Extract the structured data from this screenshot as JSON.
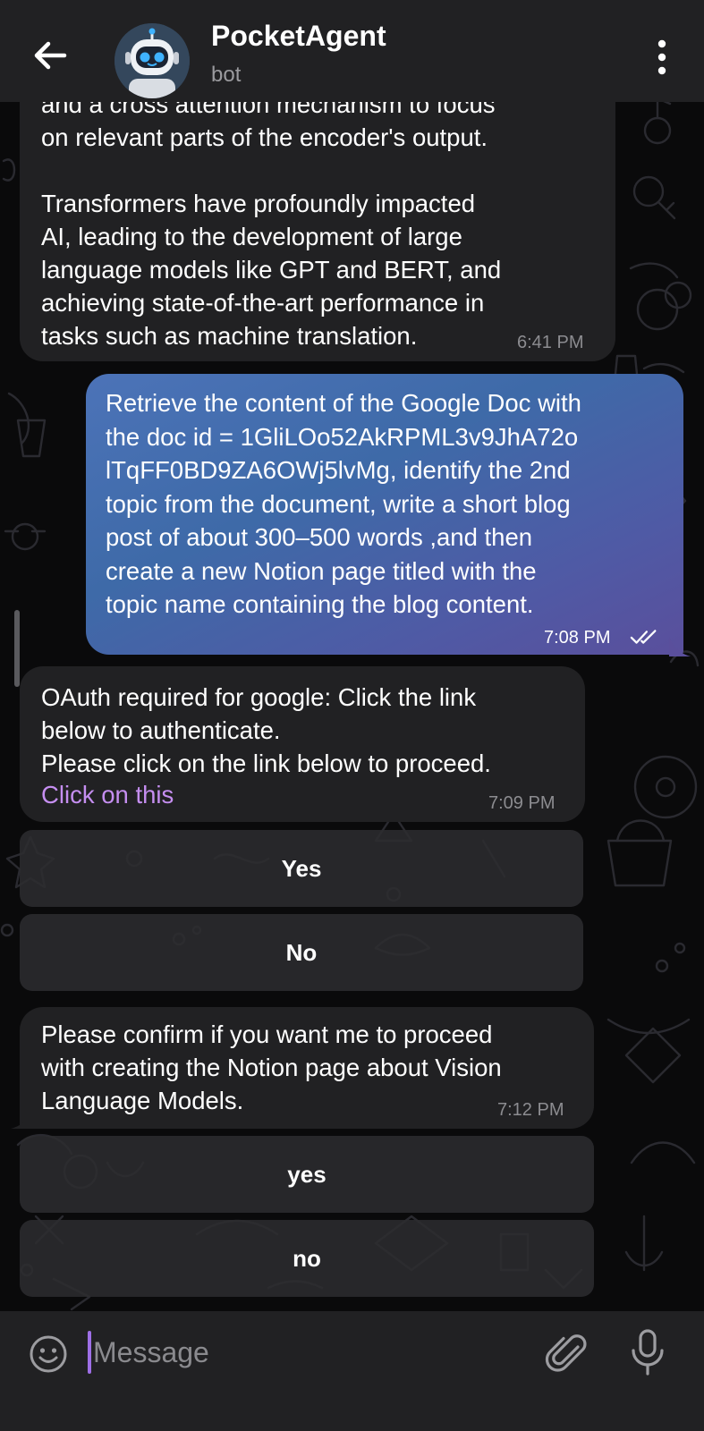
{
  "header": {
    "title": "PocketAgent",
    "subtitle": "bot"
  },
  "messages": [
    {
      "direction": "incoming",
      "text": "and a cross attention mechanism to focus\non relevant parts of the encoder's output.\n\nTransformers have profoundly impacted\nAI, leading to the development of large\nlanguage models like GPT and BERT, and\nachieving state-of-the-art performance in\ntasks such as machine translation.",
      "time": "6:41 PM"
    },
    {
      "direction": "outgoing",
      "text": "Retrieve the content of the Google Doc with\nthe doc id = 1GliLOo52AkRPML3v9JhA72o\nlTqFF0BD9ZA6OWj5lvMg, identify the 2nd\ntopic from the document, write a short blog\npost of about 300–500 words ,and then\ncreate a new Notion page titled with the\ntopic name containing the blog content.",
      "time": "7:08 PM",
      "status": "read"
    },
    {
      "direction": "incoming",
      "text": "OAuth required for google: Click the link\nbelow to authenticate.\nPlease click on the link below to proceed.",
      "link": "Click on this",
      "time": "7:09 PM",
      "buttons": [
        "Yes",
        "No"
      ]
    },
    {
      "direction": "incoming",
      "text": "Please confirm if you want me to proceed\nwith creating the Notion page about Vision\nLanguage Models.",
      "time": "7:12 PM",
      "buttons": [
        "yes",
        "no"
      ]
    }
  ],
  "input": {
    "placeholder": "Message"
  },
  "icons": {
    "back": "arrow-left-icon",
    "menu": "more-vertical-icon",
    "emoji": "smiley-icon",
    "attach": "paperclip-icon",
    "mic": "microphone-icon",
    "read_status": "double-check-icon"
  },
  "colors": {
    "header_bg": "#212123",
    "incoming_bubble": "#212123",
    "outgoing_gradient_start": "#4c73b8",
    "outgoing_gradient_end": "#5a4f9c",
    "link": "#c58ef0",
    "cursor": "#9e6fe6"
  }
}
